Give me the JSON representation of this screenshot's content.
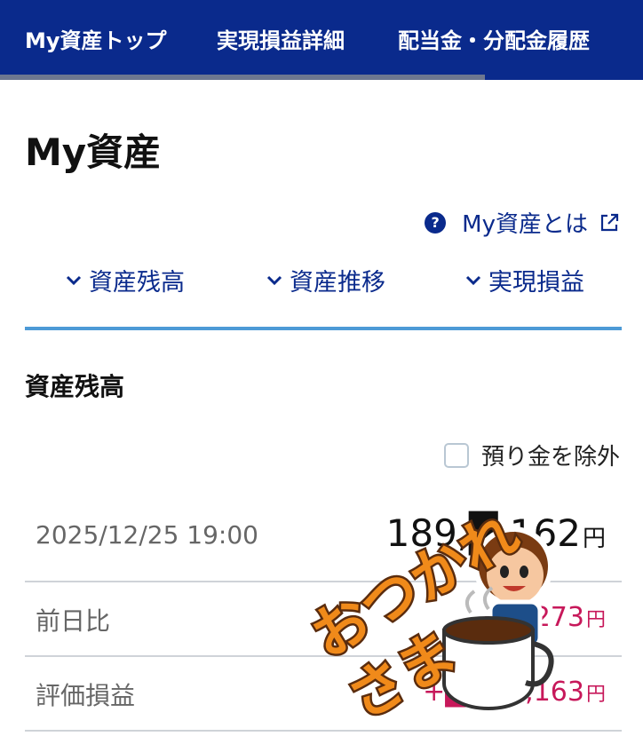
{
  "top_nav": {
    "tabs": [
      "My資産トップ",
      "実現損益詳細",
      "配当金・分配金履歴"
    ]
  },
  "page_title": "My資産",
  "help_link": {
    "label": "My資産とは"
  },
  "anchor_nav": {
    "items": [
      "資産残高",
      "資産推移",
      "実現損益"
    ]
  },
  "balance_section": {
    "title": "資産残高",
    "exclude_deposit_label": "預り金を除外",
    "rows": [
      {
        "label": "2025/12/25 19:00",
        "value": "189,█,162",
        "unit": "円"
      },
      {
        "label": "前日比",
        "value": "+█,273",
        "unit": "円"
      },
      {
        "label": "評価損益",
        "value": "+█,058,163",
        "unit": "円"
      }
    ]
  },
  "sticker": {
    "text": "おつかれさま"
  },
  "colors": {
    "nav_bg": "#0a2a8c",
    "link": "#0a2a8c",
    "divider": "#4d9ad6",
    "gain": "#c7185a"
  }
}
